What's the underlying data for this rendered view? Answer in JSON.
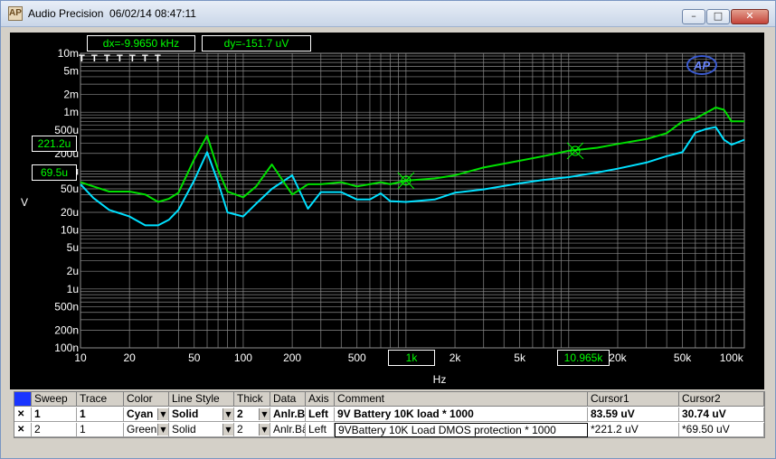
{
  "window": {
    "title": "Audio Precision  06/02/14 08:47:11",
    "min_label": "–",
    "max_label": "□",
    "close_label": "✕"
  },
  "readouts": {
    "dx": "dx=-9.9650 kHz",
    "dy": "dy=-151.7  uV",
    "cursor_y1": "221.2u",
    "cursor_y2": "69.5u",
    "cursor_x1": "1k",
    "cursor_x2": "10.965k"
  },
  "chart_data": {
    "type": "line",
    "xlabel": "Hz",
    "ylabel": "V",
    "xscale": "log",
    "yscale": "log",
    "xlim": [
      10,
      120000
    ],
    "ylim": [
      1e-07,
      0.01
    ],
    "grid": true,
    "x_tick_labels": [
      "10",
      "20",
      "50",
      "100",
      "200",
      "500",
      "1k",
      "2k",
      "5k",
      "10k",
      "20k",
      "50k",
      "100k"
    ],
    "y_tick_labels": [
      "10m",
      "5m",
      "2m",
      "1m",
      "500u",
      "200u",
      "100u",
      "50u",
      "20u",
      "10u",
      "5u",
      "2u",
      "1u",
      "500n",
      "200n",
      "100n"
    ],
    "top_markers": [
      "T",
      "T",
      "T",
      "T",
      "T",
      "T",
      "T"
    ],
    "series": [
      {
        "name": "",
        "color": "#00e0ff",
        "x": [
          10,
          12,
          15,
          20,
          25,
          30,
          35,
          40,
          50,
          60,
          70,
          80,
          100,
          120,
          150,
          200,
          250,
          300,
          400,
          500,
          600,
          700,
          800,
          1000,
          1500,
          2000,
          3000,
          5000,
          7000,
          10000,
          15000,
          20000,
          30000,
          40000,
          50000,
          60000,
          70000,
          80000,
          90000,
          100000,
          120000
        ],
        "y": [
          6e-05,
          3.5e-05,
          2.2e-05,
          1.7e-05,
          1.2e-05,
          1.2e-05,
          1.5e-05,
          2.2e-05,
          7e-05,
          0.00021,
          6.5e-05,
          2e-05,
          1.7e-05,
          2.8e-05,
          5e-05,
          8.5e-05,
          2.3e-05,
          4.4e-05,
          4.4e-05,
          3.3e-05,
          3.3e-05,
          4.2e-05,
          3.1e-05,
          3e-05,
          3.3e-05,
          4.3e-05,
          4.9e-05,
          6.2e-05,
          7.1e-05,
          7.92e-05,
          9.5e-05,
          0.00011,
          0.00014,
          0.00018,
          0.00021,
          0.00045,
          0.00052,
          0.00056,
          0.00034,
          0.00028,
          0.00034
        ]
      },
      {
        "name": "",
        "color": "#00e000",
        "x": [
          10,
          12,
          15,
          20,
          25,
          30,
          35,
          40,
          50,
          60,
          70,
          80,
          100,
          120,
          150,
          200,
          250,
          300,
          400,
          500,
          600,
          700,
          800,
          1000,
          1500,
          2000,
          3000,
          5000,
          7000,
          10000,
          15000,
          20000,
          30000,
          40000,
          50000,
          60000,
          70000,
          80000,
          90000,
          100000,
          120000
        ],
        "y": [
          6.5e-05,
          5.5e-05,
          4.5e-05,
          4.5e-05,
          4e-05,
          3e-05,
          3.4e-05,
          4.3e-05,
          0.00016,
          0.0004,
          0.000105,
          4.5e-05,
          3.6e-05,
          5.5e-05,
          0.00013,
          4e-05,
          6e-05,
          6e-05,
          6.5e-05,
          5.5e-05,
          6e-05,
          6.5e-05,
          6e-05,
          6.9e-05,
          7.5e-05,
          8.5e-05,
          0.000115,
          0.00015,
          0.00018,
          0.000221,
          0.00025,
          0.00029,
          0.00035,
          0.00044,
          0.0007,
          0.00078,
          0.00098,
          0.0012,
          0.0011,
          0.0007,
          0.0007
        ]
      }
    ]
  },
  "table": {
    "headers": [
      "Sweep",
      "Trace",
      "Color",
      "Line Style",
      "Thick",
      "Data",
      "Axis",
      "Comment",
      "Cursor1",
      "Cursor2"
    ],
    "rows": [
      {
        "mark": "✕",
        "sweep": "1",
        "trace": "1",
        "color": "Cyan",
        "style": "Solid",
        "thick": "2",
        "data": "Anlr.B",
        "axis": "Left",
        "comment": "9V Battery 10K load * 1000",
        "c1": "83.59  uV",
        "c2": "30.74  uV"
      },
      {
        "mark": "✕",
        "sweep": "2",
        "trace": "1",
        "color": "Green",
        "style": "Solid",
        "thick": "2",
        "data": "Anlr.Bä",
        "axis": "Left",
        "comment": "9VBattery 10K Load DMOS protection * 1000",
        "c1": "*221.2  uV",
        "c2": "*69.50  uV"
      }
    ]
  }
}
